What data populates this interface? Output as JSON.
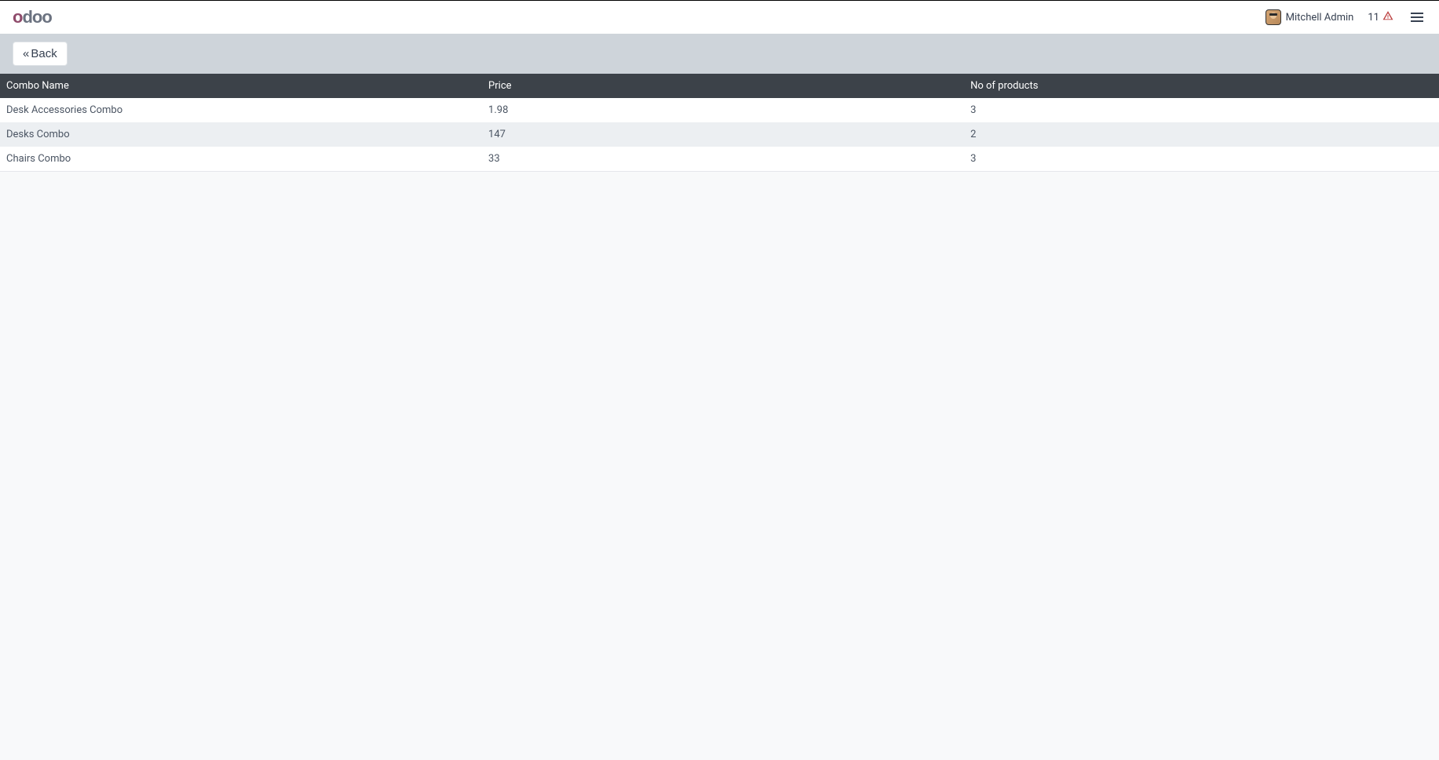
{
  "header": {
    "logo": "odoo",
    "user_name": "Mitchell Admin",
    "notif_count": "11"
  },
  "toolbar": {
    "back_label": "Back"
  },
  "table": {
    "columns": {
      "name": "Combo Name",
      "price": "Price",
      "count": "No of products"
    },
    "rows": [
      {
        "name": "Desk Accessories Combo",
        "price": "1.98",
        "count": "3"
      },
      {
        "name": "Desks Combo",
        "price": "147",
        "count": "2"
      },
      {
        "name": "Chairs Combo",
        "price": "33",
        "count": "3"
      }
    ]
  }
}
